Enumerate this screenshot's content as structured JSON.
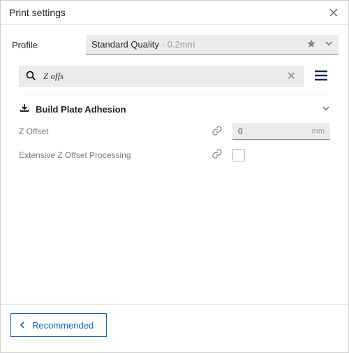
{
  "panel": {
    "title": "Print settings"
  },
  "profile": {
    "label": "Profile",
    "name": "Standard Quality",
    "detail": "- 0.2mm"
  },
  "search": {
    "value": "Z offs",
    "clear_glyph": "✕"
  },
  "section": {
    "title": "Build Plate Adhesion"
  },
  "settings": {
    "z_offset": {
      "label": "Z Offset",
      "value": "0",
      "unit": "mm"
    },
    "extensive": {
      "label": "Extensive Z Offset Processing"
    }
  },
  "footer": {
    "recommended": "Recommended"
  }
}
